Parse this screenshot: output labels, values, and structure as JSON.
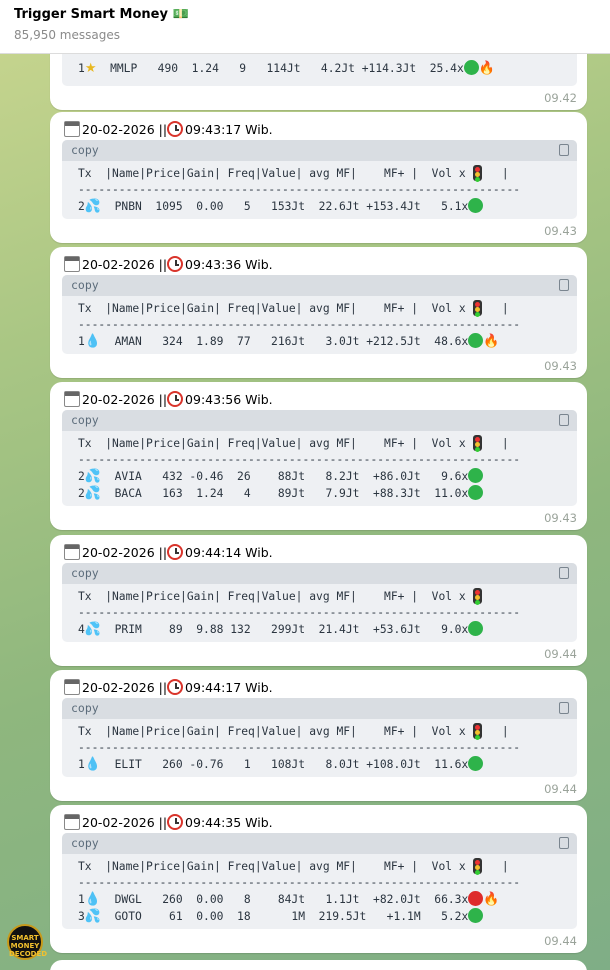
{
  "chat": {
    "title": "Trigger Smart Money",
    "title_icon": "money-bag-icon",
    "subtitle": "85,950 messages"
  },
  "avatar_text": "SMART MONEY DECODED",
  "copy_label": "copy",
  "table_header": "Tx  |Name|Price|Gain| Freq|Value| avg MF|    MF+ |  Vol x",
  "table_divider": "-----------------------------------------------------------------",
  "messages": [
    {
      "time": "09.42",
      "rows": [
        {
          "tx": "1",
          "icon": "star",
          "text": "  MMLP   490  1.24   9   114Jt   4.2Jt +114.3Jt  25.4x",
          "dots": [
            "green"
          ],
          "fire": true
        }
      ]
    },
    {
      "date": "20-02-2026 || ",
      "clock": "09:43:17 Wib.",
      "time": "09.43",
      "rows": [
        {
          "tx": "2",
          "icon": "drops",
          "text": "  PNBN  1095  0.00   5   153Jt  22.6Jt +153.4Jt   5.1x",
          "dots": [
            "green"
          ],
          "fire": false
        }
      ]
    },
    {
      "date": "20-02-2026 || ",
      "clock": "09:43:36 Wib.",
      "time": "09.43",
      "rows": [
        {
          "tx": "1",
          "icon": "drop",
          "text": "  AMAN   324  1.89  77   216Jt   3.0Jt +212.5Jt  48.6x",
          "dots": [
            "green"
          ],
          "fire": true
        }
      ]
    },
    {
      "date": "20-02-2026 || ",
      "clock": "09:43:56 Wib.",
      "time": "09.43",
      "rows": [
        {
          "tx": "2",
          "icon": "drops",
          "text": "  AVIA   432 -0.46  26    88Jt   8.2Jt  +86.0Jt   9.6x",
          "dots": [
            "green"
          ],
          "fire": false
        },
        {
          "tx": "2",
          "icon": "drops",
          "text": "  BACA   163  1.24   4    89Jt   7.9Jt  +88.3Jt  11.0x",
          "dots": [
            "green"
          ],
          "fire": false
        }
      ]
    },
    {
      "date": "20-02-2026 || ",
      "clock": "09:44:14 Wib.",
      "time": "09.44",
      "rows": [
        {
          "tx": "4",
          "icon": "drops",
          "text": "  PRIM    89  9.88 132   299Jt  21.4Jt  +53.6Jt   9.0x",
          "dots": [
            "green"
          ],
          "fire": false
        }
      ]
    },
    {
      "date": "20-02-2026 || ",
      "clock": "09:44:17 Wib.",
      "time": "09.44",
      "rows": [
        {
          "tx": "1",
          "icon": "drop",
          "text": "  ELIT   260 -0.76   1   108Jt   8.0Jt +108.0Jt  11.6x",
          "dots": [
            "green"
          ],
          "fire": false
        }
      ]
    },
    {
      "date": "20-02-2026 || ",
      "clock": "09:44:35 Wib.",
      "time": "09.44",
      "rows": [
        {
          "tx": "1",
          "icon": "drop",
          "text": "  DWGL   260  0.00   8    84Jt   1.1Jt  +82.0Jt  66.3x",
          "dots": [
            "red"
          ],
          "fire": true
        },
        {
          "tx": "3",
          "icon": "drops",
          "text": "  GOTO    61  0.00  18      1M  219.5Jt   +1.1M   5.2x",
          "dots": [
            "green"
          ],
          "fire": false
        }
      ]
    }
  ]
}
